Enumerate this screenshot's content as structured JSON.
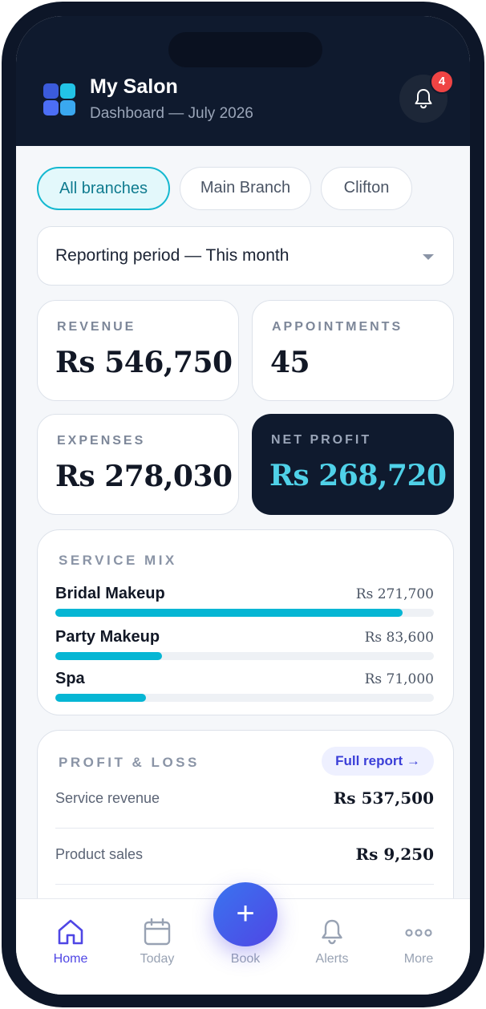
{
  "header": {
    "title": "My Salon",
    "subtitle": "Dashboard — July 2026",
    "notification_count": "4"
  },
  "branches": [
    {
      "label": "All branches",
      "active": true
    },
    {
      "label": "Main Branch",
      "active": false
    },
    {
      "label": "Clifton",
      "active": false
    }
  ],
  "period": {
    "label": "Reporting period — This month"
  },
  "kpis": {
    "revenue": {
      "label": "REVENUE",
      "value": "Rs 546,750"
    },
    "appointments": {
      "label": "APPOINTMENTS",
      "value": "45"
    },
    "expenses": {
      "label": "EXPENSES",
      "value": "Rs 278,030"
    },
    "net_profit": {
      "label": "NET PROFIT",
      "value": "Rs 268,720"
    }
  },
  "service_mix": {
    "title": "SERVICE MIX",
    "items": [
      {
        "name": "Bridal Makeup",
        "amount": "Rs 271,700",
        "value": 271700
      },
      {
        "name": "Party Makeup",
        "amount": "Rs 83,600",
        "value": 83600
      },
      {
        "name": "Spa",
        "amount": "Rs 71,000",
        "value": 71000
      }
    ],
    "max": 296000
  },
  "pnl": {
    "title": "PROFIT & LOSS",
    "full_report": "Full report →",
    "rows": [
      {
        "label": "Service revenue",
        "value": "Rs 537,500"
      },
      {
        "label": "Product sales",
        "value": "Rs 9,250"
      }
    ]
  },
  "tabs": {
    "home": "Home",
    "today": "Today",
    "book": "Book",
    "alerts": "Alerts",
    "more": "More"
  },
  "colors": {
    "accent": "#06b6d4",
    "primary": "#4f46e5",
    "dark": "#0f1a2e",
    "badge": "#ef4444"
  }
}
